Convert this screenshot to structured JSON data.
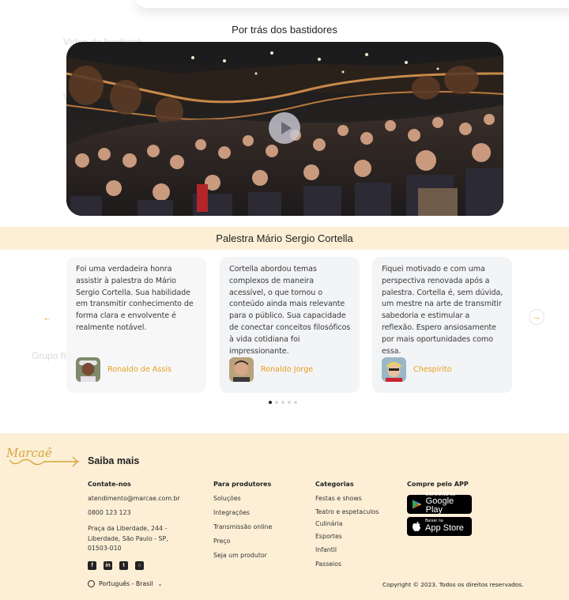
{
  "ghost_labels": {
    "video_feedback": "Vídeo de feedback",
    "v_fragment": "V",
    "grupo_final": "Grupo final"
  },
  "behind_scenes": {
    "title": "Por trás dos bastidores",
    "play_icon": "play-icon"
  },
  "testimonials": {
    "title": "Palestra Mário Sergio Cortella",
    "prev_icon": "arrow-left-icon",
    "next_icon": "arrow-right-icon",
    "items": [
      {
        "text": "Foi uma verdadeira honra assistir à palestra do Mário Sergio Cortella. Sua habilidade em transmitir conhecimento de forma clara e envolvente é realmente notável.",
        "author": "Ronaldo de Assis"
      },
      {
        "text": "Cortella abordou temas complexos de maneira acessível, o que tornou o conteúdo ainda mais relevante para o público. Sua capacidade de conectar conceitos filosóficos à vida cotidiana foi impressionante.",
        "author": "Ronaldo Jorge"
      },
      {
        "text": "Fiquei motivado e com uma perspectiva renovada após a palestra. Cortella é, sem dúvida, um mestre na arte de transmitir sabedoria e estimular a reflexão. Espero ansiosamente por mais oportunidades como essa.",
        "author": "Chespirito"
      }
    ],
    "dots_total": 5,
    "dots_active_index": 0
  },
  "footer": {
    "logo_text": "Marcaê",
    "heading": "Saiba mais",
    "contact": {
      "title": "Contate-nos",
      "email": "atendimento@marcae.com.br",
      "phone": "0800 123 123",
      "address_line1": "Praça da Liberdade, 244 -",
      "address_line2": "Liberdade, São Paulo - SP,",
      "address_line3": "01503-010"
    },
    "producers": {
      "title": "Para produtores",
      "items": [
        "Soluções",
        "Integrações",
        "Transmissão online",
        "Preço",
        "Seja um produtor"
      ]
    },
    "categories": {
      "title": "Categorias",
      "items": [
        "Festas e shows",
        "Teatro e espetaculos",
        "Culinária",
        "Esportes",
        "Infantil",
        "Passeios"
      ]
    },
    "app": {
      "title": "Compre pelo APP",
      "google_small": "DISPONÍVEL NO",
      "google_big": "Google Play",
      "apple_small": "Baixar na",
      "apple_big": "App Store"
    },
    "socials": [
      "facebook-icon",
      "linkedin-icon",
      "twitter-icon",
      "instagram-icon"
    ],
    "language": "Português - Brasil",
    "copyright": "Copyright © 2023. Todos os direitos reservados."
  },
  "colors": {
    "accent": "#e5a11e",
    "band_bg": "#fcefd6",
    "card_bg": "#f3f4f6"
  }
}
